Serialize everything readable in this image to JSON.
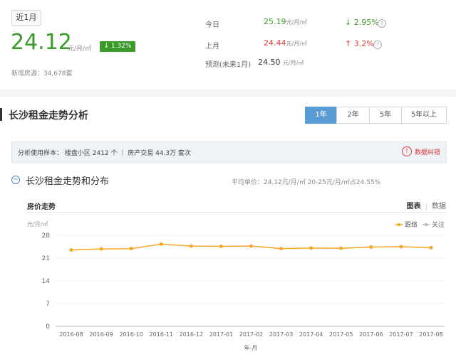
{
  "summary": {
    "period": "近1月",
    "price": "24.12",
    "unit": "元/月/㎡",
    "change": "1.32%",
    "listings": "新增房源：34,678套",
    "today_label": "今日",
    "today_price": "25.19",
    "today_unit": "元/月/㎡",
    "today_change": "2.95%",
    "lastmonth_label": "上月",
    "lastmonth_price": "24.44",
    "lastmonth_unit": "元/月/㎡",
    "lastmonth_change": "3.2%",
    "forecast_label": "预测(未来1月)",
    "forecast_price": "24.50",
    "forecast_unit": "元/月/㎡"
  },
  "section": {
    "title": "长沙租金走势分析",
    "tabs": [
      "1年",
      "2年",
      "5年",
      "5年以上"
    ],
    "sample": "分析使用样本：  楼盘小区 2412 个   ｜  房产交易 44.3万 套次",
    "report": "数据纠错"
  },
  "chart_section": {
    "title": "长沙租金走势和分布",
    "avg": "平均单价：24.12元/月/㎡     20-25元/月/㎡占24.55%",
    "label": "房价走势",
    "view_chart": "图表",
    "view_data": "数据"
  },
  "colors": {
    "green": "#3a9a2a",
    "red": "#e03b3b",
    "line": "#f5a623",
    "tab": "#5b9bd5"
  },
  "chart_data": {
    "type": "line",
    "ylabel": "元/月/㎡",
    "xlabel": "年-月",
    "ylim": [
      0,
      28
    ],
    "yticks": [
      0,
      7,
      14,
      21,
      28
    ],
    "categories": [
      "2016-08",
      "2016-09",
      "2016-10",
      "2016-11",
      "2016-12",
      "2017-01",
      "2017-02",
      "2017-03",
      "2017-04",
      "2017-05",
      "2017-06",
      "2017-07",
      "2017-08"
    ],
    "series": [
      {
        "name": "跟络",
        "color": "#f5a623",
        "values": [
          23.5,
          23.8,
          23.9,
          25.3,
          24.7,
          24.6,
          24.7,
          23.9,
          24.1,
          24.0,
          24.4,
          24.5,
          24.2
        ]
      }
    ],
    "legend": [
      {
        "name": "跟络",
        "color": "#f5a623"
      },
      {
        "name": "关注",
        "color": "#bbbbbb"
      }
    ]
  }
}
